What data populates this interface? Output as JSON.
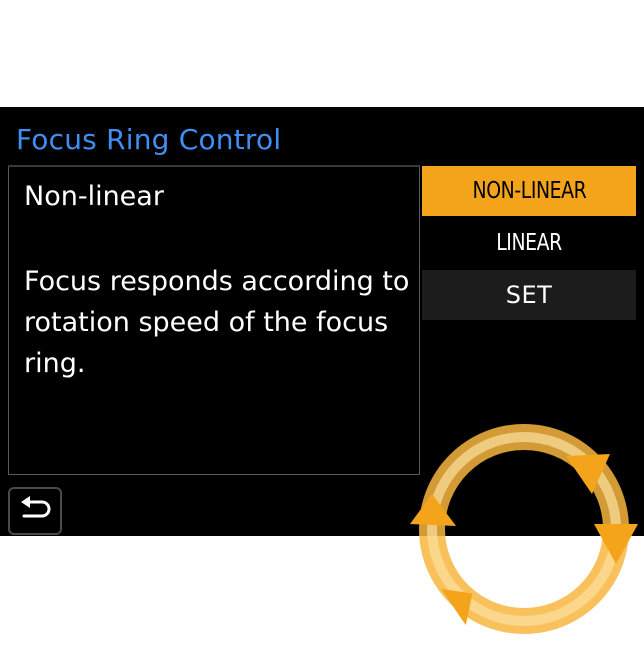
{
  "screen": {
    "title": "Focus Ring Control",
    "info": {
      "heading": "Non-linear",
      "description": "Focus responds according to rotation speed of the focus ring."
    },
    "options": [
      {
        "label": "NON-LINEAR",
        "state": "selected"
      },
      {
        "label": "LINEAR",
        "state": "normal"
      },
      {
        "label": "SET",
        "state": "action"
      }
    ],
    "back_icon": "return-arrow-icon"
  },
  "overlay": {
    "icon": "rotate-dial-icon",
    "color": "#f4a41a"
  },
  "colors": {
    "title": "#3f8ff2",
    "selected_bg": "#f4a41a",
    "screen_bg": "#000000"
  }
}
